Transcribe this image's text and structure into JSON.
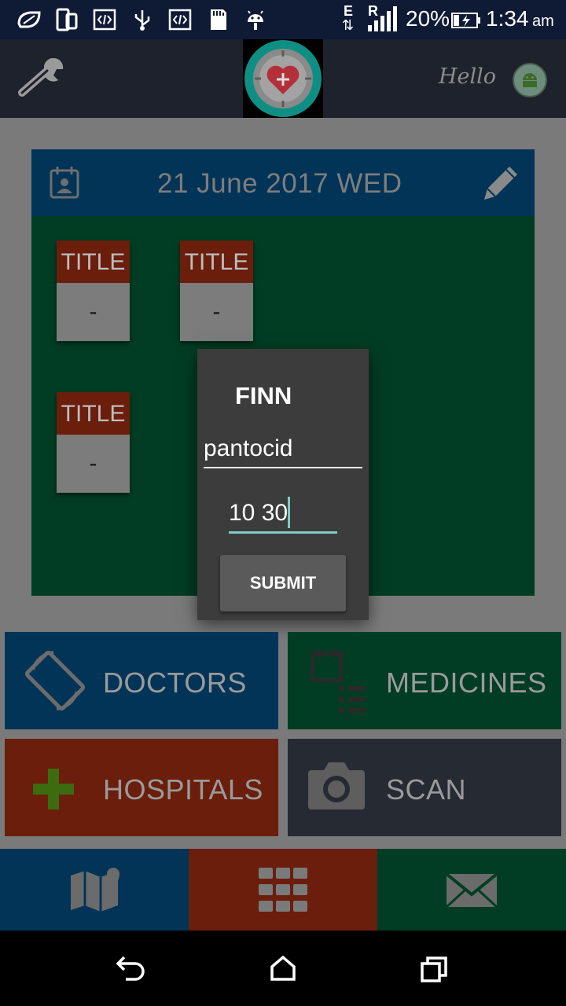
{
  "status_bar": {
    "network_label_top": "E",
    "network_label_mid": "R",
    "battery": "20%",
    "time": "1:34",
    "ampm": "am",
    "bg": "#0f1a35"
  },
  "toolbar": {
    "greeting": "Hello",
    "bg": "#1d222c"
  },
  "date_header": {
    "date": "21 June 2017 WED",
    "bg": "#023457"
  },
  "cards": [
    {
      "title": "TITLE",
      "value": "-"
    },
    {
      "title": "TITLE",
      "value": "-"
    },
    {
      "title": "TITLE",
      "value": "-"
    }
  ],
  "dialog": {
    "title": "FINN",
    "name_value": "pantocid",
    "time_value": "10 30",
    "submit_label": "SUBMIT"
  },
  "tiles": {
    "doctors": {
      "label": "DOCTORS",
      "bg": "#023457"
    },
    "medicines": {
      "label": "MEDICINES",
      "bg": "#003d24"
    },
    "hospitals": {
      "label": "HOSPITALS",
      "bg": "#6a1e0b"
    },
    "scan": {
      "label": "SCAN",
      "bg": "#262a33"
    }
  },
  "bottom_tabs": [
    {
      "icon": "map-icon",
      "bg": "#023457"
    },
    {
      "icon": "grid-icon",
      "bg": "#6a1e0b"
    },
    {
      "icon": "mail-icon",
      "bg": "#003d24"
    }
  ],
  "nav_bar": {
    "icons": [
      "back-icon",
      "home-icon",
      "recents-icon"
    ]
  }
}
